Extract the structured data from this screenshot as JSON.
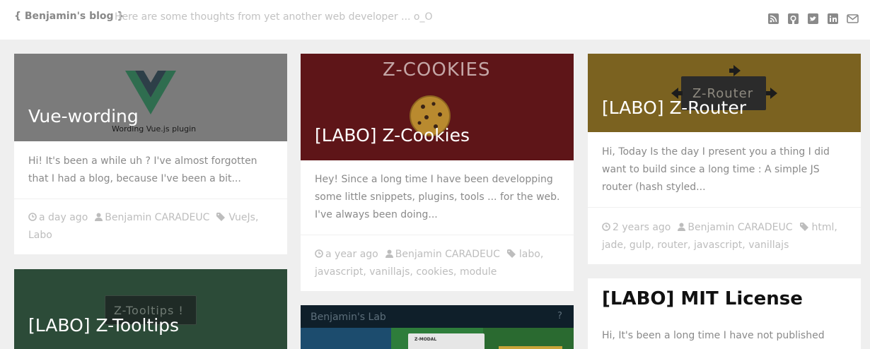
{
  "header": {
    "brand": "{ Benjamin's blog }",
    "tagline": "Here are some thoughts from yet another web developer ... o_O",
    "social_icons": [
      "rss-icon",
      "github-icon",
      "twitter-icon",
      "linkedin-icon",
      "mail-icon"
    ]
  },
  "posts": [
    {
      "title": "Vue-wording",
      "cover_caption": "Wording Vue.js plugin",
      "cover_color": "#7b7b7b",
      "excerpt": "Hi! It's been a while uh ? I've almost forgotten that I had a blog, because I've been a bit...",
      "time": "a day ago",
      "author": "Benjamin CARADEUC",
      "tags": "VueJs, Labo"
    },
    {
      "title": "[LABO] Z-Cookies",
      "cover_caption": "Z-COOKIES",
      "cover_color": "#5e1518",
      "excerpt": "Hey! Since a long time I have been developping some little snippets, plugins, tools ... for the web. I've always been doing...",
      "time": "a year ago",
      "author": "Benjamin CARADEUC",
      "tags": "labo, javascript, vanillajs, cookies, module"
    },
    {
      "title": "[LABO] Z-Router",
      "cover_caption": "Z-Router",
      "cover_color": "#7b6220",
      "excerpt": "Hi, Today Is the day I present you a thing I did want to build since a long time : A simple JS router (hash styled...",
      "time": "2 years ago",
      "author": "Benjamin CARADEUC",
      "tags": "html, jade, gulp, router, javascript, vanillajs"
    },
    {
      "title": "[LABO] Z-Tooltips",
      "cover_caption": "Z-Tooltips !",
      "cover_color": "#2c4b38"
    },
    {
      "cover_caption": "Benjamin's Lab",
      "cover_caption_2": "Z-MODAL",
      "cover_color": "#0f1f2a"
    },
    {
      "title": "[LABO] MIT License",
      "excerpt": "Hi, It's been a long time I have not published"
    }
  ]
}
